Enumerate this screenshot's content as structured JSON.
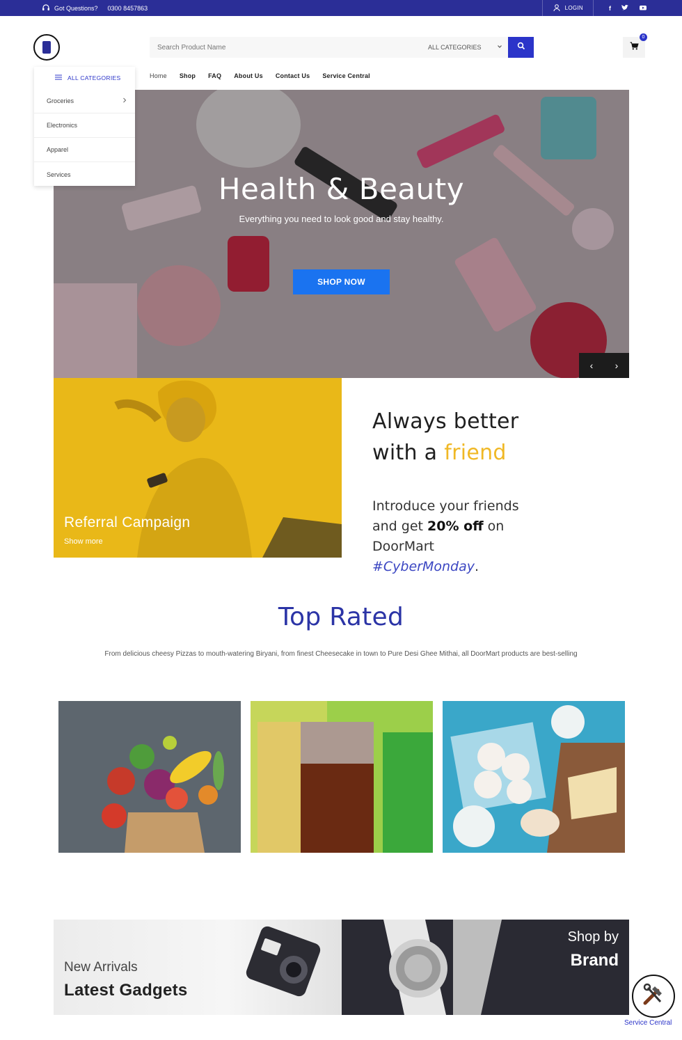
{
  "topbar": {
    "questions": "Got Questions?",
    "phone": "0300 8457863",
    "login": "LOGIN",
    "social_icons": [
      "facebook-icon",
      "twitter-icon",
      "youtube-icon"
    ]
  },
  "search": {
    "placeholder": "Search Product Name",
    "category": "ALL CATEGORIES"
  },
  "cart": {
    "count": "0"
  },
  "nav": {
    "items": [
      "Home",
      "Shop",
      "FAQ",
      "About Us",
      "Contact Us",
      "Service Central"
    ]
  },
  "categories": {
    "title": "ALL CATEGORIES",
    "items": [
      "Groceries",
      "Electronics",
      "Apparel",
      "Services"
    ]
  },
  "hero": {
    "title": "Health & Beauty",
    "subtitle": "Everything you need to look good and stay healthy.",
    "button": "SHOP NOW",
    "prev": "‹",
    "next": "›"
  },
  "referral": {
    "title": "Referral Campaign",
    "link": "Show more"
  },
  "friend": {
    "line1": "Always better",
    "line2_prefix": "with a",
    "line2_highlight": "friend",
    "p1": "Introduce your friends",
    "p2_prefix": "and get",
    "p2_bold": "20% off",
    "p2_suffix": "on",
    "p3": "DoorMart",
    "hashtag": "#CyberMonday",
    "period": "."
  },
  "top_rated": {
    "title": "Top Rated",
    "description": "From delicious cheesy Pizzas to mouth-watering Biryani, from finest Cheesecake in town to Pure Desi Ghee Mithai, all DoorMart products are best-selling"
  },
  "banners": {
    "left_small": "New Arrivals",
    "left_big": "Latest Gadgets",
    "right_small": "Shop by",
    "right_big": "Brand"
  },
  "service_central": {
    "label": "Service Central"
  },
  "colors": {
    "brand": "#2b2e97",
    "accent": "#2b34c9",
    "shop_button": "#1a73f0",
    "highlight": "#f0b825",
    "referral_bg": "#e8b81a"
  }
}
